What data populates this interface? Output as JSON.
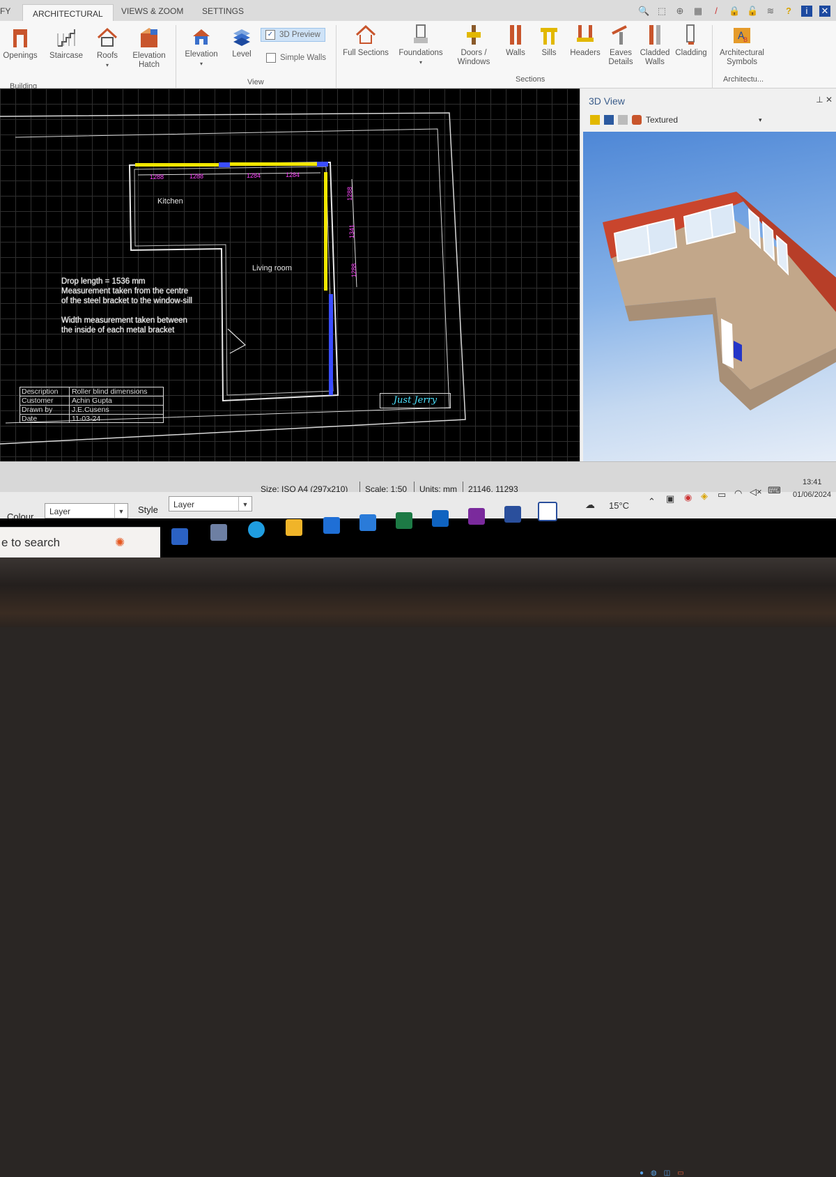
{
  "tabs": {
    "partial_left": "FY",
    "architectural": "ARCHITECTURAL",
    "views_zoom": "VIEWS & ZOOM",
    "settings": "SETTINGS"
  },
  "ribbon": {
    "building": {
      "openings": "Openings",
      "staircase": "Staircase",
      "roofs": "Roofs",
      "elevation_hatch": "Elevation Hatch",
      "group": "Building"
    },
    "view": {
      "elevation": "Elevation",
      "level": "Level",
      "preview3d": "3D Preview",
      "simple_walls": "Simple Walls",
      "group": "View"
    },
    "sections": {
      "full_sections": "Full Sections",
      "foundations": "Foundations",
      "doors_windows": "Doors / Windows",
      "walls": "Walls",
      "sills": "Sills",
      "headers": "Headers",
      "eaves_details": "Eaves Details",
      "cladded_walls": "Cladded Walls",
      "cladding": "Cladding",
      "group": "Sections"
    },
    "architectural": {
      "symbols": "Architectural Symbols",
      "group": "Architectu..."
    }
  },
  "drawing": {
    "rooms": {
      "kitchen": "Kitchen",
      "living_room": "Living room"
    },
    "dims_top": [
      "1288",
      "1288",
      "1284",
      "1284"
    ],
    "dims_right": [
      "1288",
      "1341",
      "1288"
    ],
    "notes": {
      "drop": "Drop length = 1536 mm",
      "measure1": "Measurement taken from the centre",
      "measure2": "of the steel bracket to the window-sill",
      "width1": "Width measurement taken between",
      "width2": "the inside of each metal bracket"
    },
    "titleblock": [
      {
        "k": "Description",
        "v": "Roller blind dimensions"
      },
      {
        "k": "Customer",
        "v": "Achin Gupta"
      },
      {
        "k": "Drawn by",
        "v": "J.E.Cusens"
      },
      {
        "k": "Date",
        "v": "11-03-24"
      }
    ],
    "signature": "Just Jerry"
  },
  "panel3d": {
    "title": "3D View",
    "mode": "Textured"
  },
  "status": {
    "size": "Size: ISO A4 (297x210)",
    "scale": "Scale: 1:50",
    "units": "Units: mm",
    "coords": "21146, 11293"
  },
  "controls": {
    "colour_label": "Colour",
    "colour_value": "Layer",
    "style_label": "Style",
    "style_value": "Layer"
  },
  "taskbar": {
    "search": "e to search",
    "weather": "15°C",
    "time": "13:41",
    "date": "01/06/2024"
  },
  "colors": {
    "ribbon_bg": "#f7f7f7",
    "canvas_bg": "#000000",
    "dim_magenta": "#ff46ff",
    "wall_yellow": "#f2e600",
    "window_blue": "#3a4dff",
    "sky_top": "#4e87d6",
    "brick": "#c9452d"
  }
}
